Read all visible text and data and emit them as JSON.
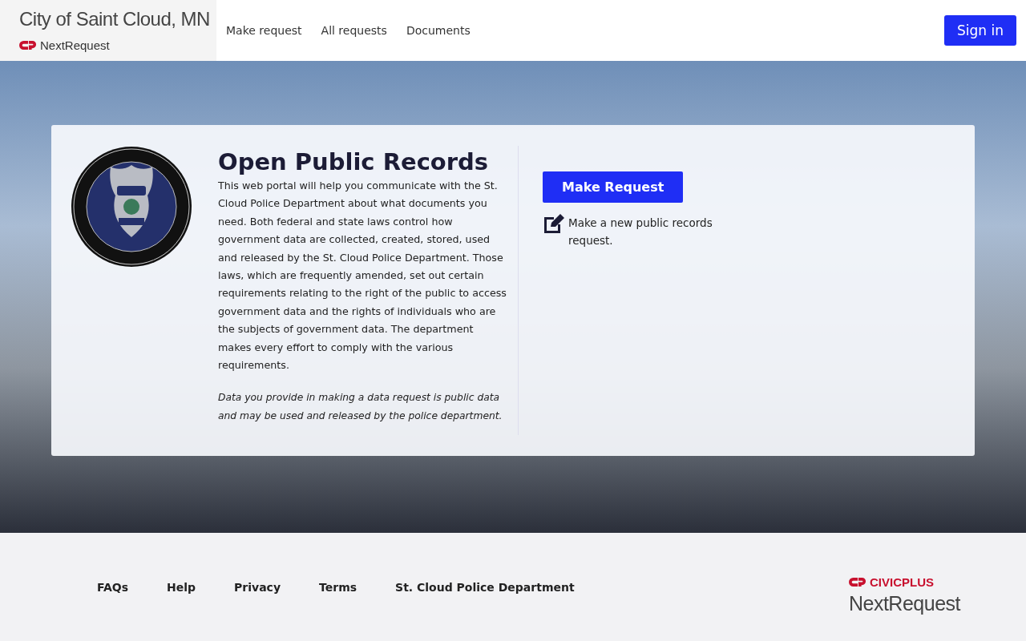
{
  "header": {
    "city": "City of Saint Cloud, MN",
    "brand": "NextRequest",
    "nav": [
      {
        "label": "Make request"
      },
      {
        "label": "All requests"
      },
      {
        "label": "Documents"
      }
    ],
    "sign_in": "Sign in"
  },
  "intro": {
    "title": "Open Public Records",
    "body": "This web portal will help you communicate with the St. Cloud Police Department about what documents you need. Both federal and state laws control how government data are collected, created, stored, used and released by the St. Cloud Police Department. Those laws, which are frequently amended, set out certain requirements relating to the right of the public to access government data and the rights of individuals who are the subjects of government data. The department makes every effort to comply with the various requirements.",
    "note": "Data you provide in making a data request is public data and may be used and released by the police department.",
    "button": "Make Request",
    "hint": "Make a new public records request."
  },
  "footer": {
    "links": [
      {
        "label": "FAQs"
      },
      {
        "label": "Help"
      },
      {
        "label": "Privacy"
      },
      {
        "label": "Terms"
      },
      {
        "label": "St. Cloud Police Department"
      }
    ],
    "company": "CIVICPLUS",
    "product": "NextRequest"
  }
}
